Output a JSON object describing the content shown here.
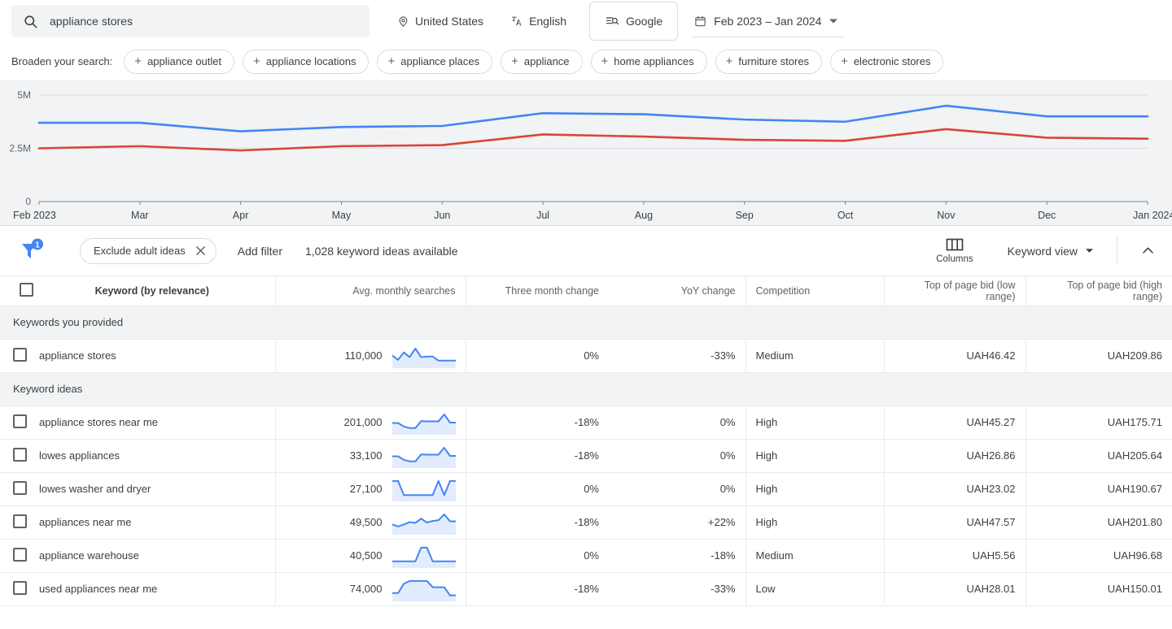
{
  "search": {
    "value": "appliance stores",
    "icon": "search-icon"
  },
  "topbar": {
    "location": "United States",
    "language": "English",
    "network": "Google",
    "date_range": "Feb 2023 – Jan 2024"
  },
  "broaden": {
    "label": "Broaden your search:",
    "chips": [
      "appliance outlet",
      "appliance locations",
      "appliance places",
      "appliance",
      "home appliances",
      "furniture stores",
      "electronic stores"
    ]
  },
  "toolbar": {
    "filter_badge": "1",
    "exclude_chip": "Exclude adult ideas",
    "add_filter": "Add filter",
    "idea_count": "1,028 keyword ideas available",
    "columns_label": "Columns",
    "keyword_view": "Keyword view"
  },
  "table": {
    "headers": {
      "keyword": "Keyword (by relevance)",
      "avg": "Avg. monthly searches",
      "three_month": "Three month change",
      "yoy": "YoY change",
      "competition": "Competition",
      "bid_low": "Top of page bid (low range)",
      "bid_high": "Top of page bid (high range)"
    },
    "group_provided": "Keywords you provided",
    "group_ideas": "Keyword ideas",
    "rows_provided": [
      {
        "keyword": "appliance stores",
        "avg": "110,000",
        "three_month": "0%",
        "yoy": "-33%",
        "competition": "Medium",
        "bid_low": "UAH46.42",
        "bid_high": "UAH209.86",
        "spark": [
          52,
          30,
          68,
          44,
          88,
          44,
          47,
          47,
          26,
          26,
          26,
          26
        ]
      }
    ],
    "rows_ideas": [
      {
        "keyword": "appliance stores near me",
        "avg": "201,000",
        "three_month": "-18%",
        "yoy": "0%",
        "competition": "High",
        "bid_low": "UAH45.27",
        "bid_high": "UAH175.71",
        "spark": [
          48,
          48,
          30,
          22,
          22,
          58,
          56,
          56,
          56,
          92,
          50,
          50
        ]
      },
      {
        "keyword": "lowes appliances",
        "avg": "33,100",
        "three_month": "-18%",
        "yoy": "0%",
        "competition": "High",
        "bid_low": "UAH26.86",
        "bid_high": "UAH205.64",
        "spark": [
          48,
          48,
          30,
          22,
          22,
          58,
          56,
          56,
          56,
          92,
          50,
          50
        ]
      },
      {
        "keyword": "lowes washer and dryer",
        "avg": "27,100",
        "three_month": "0%",
        "yoy": "0%",
        "competition": "High",
        "bid_low": "UAH23.02",
        "bid_high": "UAH190.67",
        "spark": [
          92,
          92,
          20,
          20,
          20,
          20,
          20,
          20,
          92,
          20,
          92,
          92
        ]
      },
      {
        "keyword": "appliances near me",
        "avg": "49,500",
        "three_month": "-18%",
        "yoy": "+22%",
        "competition": "High",
        "bid_low": "UAH47.57",
        "bid_high": "UAH201.80",
        "spark": [
          40,
          30,
          40,
          52,
          48,
          70,
          50,
          58,
          62,
          92,
          56,
          56
        ]
      },
      {
        "keyword": "appliance warehouse",
        "avg": "40,500",
        "three_month": "0%",
        "yoy": "-18%",
        "competition": "Medium",
        "bid_low": "UAH5.56",
        "bid_high": "UAH96.68",
        "spark": [
          22,
          22,
          22,
          22,
          22,
          92,
          92,
          22,
          22,
          22,
          22,
          22
        ]
      },
      {
        "keyword": "used appliances near me",
        "avg": "74,000",
        "three_month": "-18%",
        "yoy": "-33%",
        "competition": "Low",
        "bid_low": "UAH28.01",
        "bid_high": "UAH150.01",
        "spark": [
          30,
          30,
          78,
          92,
          92,
          92,
          92,
          60,
          60,
          60,
          18,
          18
        ]
      }
    ]
  },
  "chart_data": {
    "type": "line",
    "title": "",
    "xlabel": "",
    "ylabel": "",
    "ylim": [
      0,
      5000000
    ],
    "yticks": [
      0,
      2500000,
      5000000
    ],
    "ytick_labels": [
      "0",
      "2.5M",
      "5M"
    ],
    "grid": true,
    "legend": "none",
    "categories": [
      "Feb 2023",
      "Mar",
      "Apr",
      "May",
      "Jun",
      "Jul",
      "Aug",
      "Sep",
      "Oct",
      "Nov",
      "Dec",
      "Jan 2024"
    ],
    "series": [
      {
        "name": "searches-blue",
        "color": "#4285f4",
        "values": [
          3700000,
          3700000,
          3300000,
          3500000,
          3550000,
          4150000,
          4100000,
          3850000,
          3750000,
          4500000,
          4000000,
          4000000
        ]
      },
      {
        "name": "searches-red",
        "color": "#db4437",
        "values": [
          2500000,
          2600000,
          2400000,
          2600000,
          2650000,
          3150000,
          3050000,
          2900000,
          2850000,
          3400000,
          3000000,
          2950000
        ]
      }
    ]
  }
}
